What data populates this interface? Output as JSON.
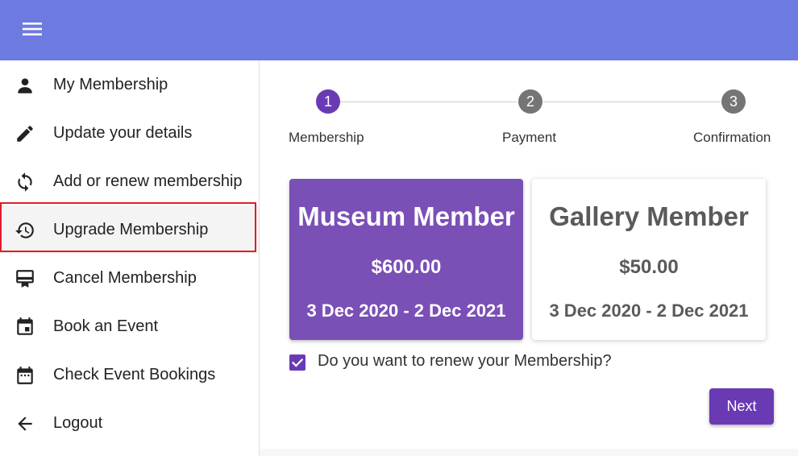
{
  "header": {
    "menu_icon": "hamburger-menu-icon",
    "color": "#6d7be0"
  },
  "sidebar": {
    "items": [
      {
        "label": "My Membership",
        "icon": "person-icon"
      },
      {
        "label": "Update your details",
        "icon": "pencil-icon"
      },
      {
        "label": "Add or renew membership",
        "icon": "sync-icon"
      },
      {
        "label": "Upgrade Membership",
        "icon": "upgrade-restore-icon",
        "active": true
      },
      {
        "label": "Cancel Membership",
        "icon": "card-membership-icon"
      },
      {
        "label": "Book an Event",
        "icon": "calendar-event-icon"
      },
      {
        "label": "Check Event Bookings",
        "icon": "calendar-dots-icon"
      },
      {
        "label": "Logout",
        "icon": "arrow-left-icon"
      }
    ]
  },
  "stepper": {
    "steps": [
      {
        "number": "1",
        "label": "Membership",
        "active": true
      },
      {
        "number": "2",
        "label": "Payment",
        "active": false
      },
      {
        "number": "3",
        "label": "Confirmation",
        "active": false
      }
    ]
  },
  "cards": [
    {
      "title": "Museum Member",
      "price": "$600.00",
      "dates": "3 Dec 2020 - 2 Dec 2021",
      "selected": true
    },
    {
      "title": "Gallery Member",
      "price": "$50.00",
      "dates": "3 Dec 2020 - 2 Dec 2021",
      "selected": false
    }
  ],
  "renew": {
    "checked": true,
    "label": "Do you want to renew your Membership?"
  },
  "actions": {
    "next_label": "Next"
  },
  "colors": {
    "accent": "#6a3ab4",
    "selected_card": "#7a4fb6",
    "highlight": "#e01e28"
  }
}
